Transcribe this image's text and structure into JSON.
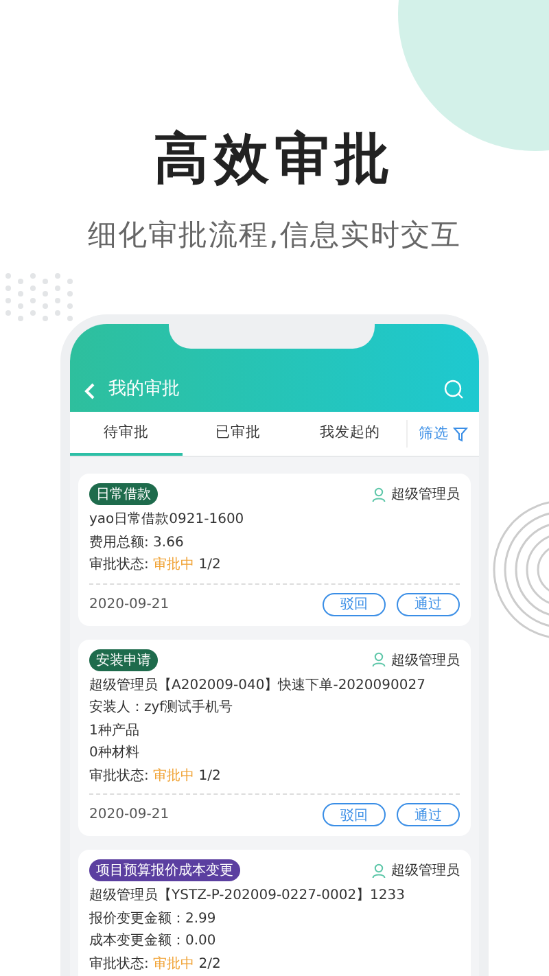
{
  "headline": "高效审批",
  "subtitle": "细化审批流程,信息实时交互",
  "app": {
    "title": "我的审批",
    "tabs": [
      {
        "label": "待审批",
        "selected": true
      },
      {
        "label": "已审批",
        "selected": false
      },
      {
        "label": "我发起的",
        "selected": false
      }
    ],
    "filter": "筛选",
    "cards": [
      {
        "tag": {
          "text": "日常借款",
          "color": "#1e6b4c"
        },
        "user": "超级管理员",
        "lines": [
          {
            "kind": "text",
            "text": "yao日常借款0921-1600"
          },
          {
            "kind": "text",
            "text": "费用总额: 3.66"
          },
          {
            "kind": "status",
            "label": "审批状态:",
            "status": "审批中",
            "progress": "1/2"
          }
        ],
        "date": "2020-09-21",
        "buttons": [
          "驳回",
          "通过"
        ]
      },
      {
        "tag": {
          "text": "安装申请",
          "color": "#1e6b4c"
        },
        "user": "超级管理员",
        "lines": [
          {
            "kind": "text",
            "text": "超级管理员【A202009-040】快速下单-2020090027"
          },
          {
            "kind": "text",
            "text": "安装人：zyf测试手机号"
          },
          {
            "kind": "text",
            "text": "1种产品"
          },
          {
            "kind": "text",
            "text": "0种材料"
          },
          {
            "kind": "status",
            "label": "审批状态:",
            "status": "审批中",
            "progress": "1/2"
          }
        ],
        "date": "2020-09-21",
        "buttons": [
          "驳回",
          "通过"
        ]
      },
      {
        "tag": {
          "text": "项目预算报价成本变更",
          "color": "#5b3fa0"
        },
        "user": "超级管理员",
        "lines": [
          {
            "kind": "text",
            "text": "超级管理员【YSTZ-P-202009-0227-0002】1233"
          },
          {
            "kind": "text",
            "text": "报价变更金额：2.99"
          },
          {
            "kind": "text",
            "text": "成本变更金额：0.00"
          },
          {
            "kind": "status",
            "label": "审批状态:",
            "status": "审批中",
            "progress": "2/2"
          }
        ]
      }
    ]
  }
}
